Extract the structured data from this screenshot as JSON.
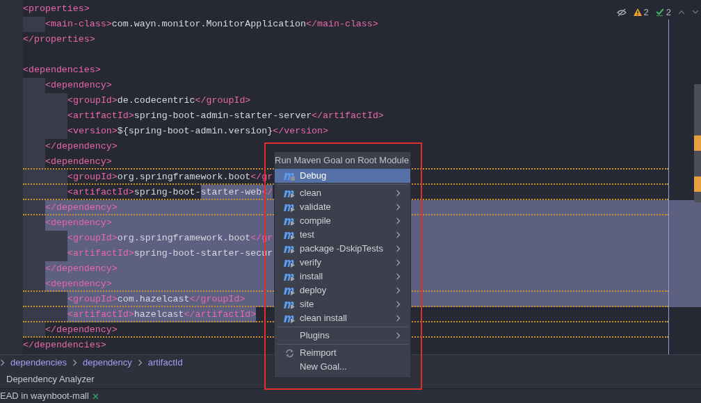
{
  "editor": {
    "inspections": {
      "warnings": "2",
      "weak_warnings": "2"
    },
    "lines": [
      {
        "selected": false,
        "warning": false,
        "tokens": [
          {
            "kind": "tag",
            "text": "<properties>"
          }
        ]
      },
      {
        "selected": false,
        "warning": false,
        "tokens": [
          {
            "kind": "indent"
          },
          {
            "kind": "tag",
            "text": "<main-class>"
          },
          {
            "kind": "text",
            "text": "com.wayn.monitor.MonitorApplication"
          },
          {
            "kind": "tag",
            "text": "</main-class>"
          }
        ]
      },
      {
        "selected": false,
        "warning": false,
        "tokens": [
          {
            "kind": "tag",
            "text": "</properties>"
          }
        ]
      },
      {
        "selected": false,
        "warning": false
      },
      {
        "selected": false,
        "warning": false,
        "tokens": [
          {
            "kind": "tag",
            "text": "<dependencies>"
          }
        ]
      },
      {
        "selected": false,
        "warning": false,
        "tokens": [
          {
            "kind": "indent"
          },
          {
            "kind": "tag",
            "text": "<dependency>"
          }
        ]
      },
      {
        "selected": false,
        "warning": false,
        "tokens": [
          {
            "kind": "indent"
          },
          {
            "kind": "indent"
          },
          {
            "kind": "tag",
            "text": "<groupId>"
          },
          {
            "kind": "text",
            "text": "de.codecentric"
          },
          {
            "kind": "tag",
            "text": "</groupId>"
          }
        ]
      },
      {
        "selected": false,
        "warning": false,
        "tokens": [
          {
            "kind": "indent"
          },
          {
            "kind": "indent"
          },
          {
            "kind": "tag",
            "text": "<artifactId>"
          },
          {
            "kind": "text",
            "text": "spring-boot-admin-starter-server"
          },
          {
            "kind": "tag",
            "text": "</artifactId>"
          }
        ]
      },
      {
        "selected": false,
        "warning": false,
        "tokens": [
          {
            "kind": "indent"
          },
          {
            "kind": "indent"
          },
          {
            "kind": "tag",
            "text": "<version>"
          },
          {
            "kind": "text",
            "text": "${spring-boot-admin.version}"
          },
          {
            "kind": "tag",
            "text": "</version>"
          }
        ]
      },
      {
        "selected": false,
        "warning": false,
        "tokens": [
          {
            "kind": "indent"
          },
          {
            "kind": "tag",
            "text": "</dependency>"
          }
        ]
      },
      {
        "selected": false,
        "warning": true,
        "tokens": [
          {
            "kind": "indent"
          },
          {
            "kind": "tag",
            "text": "<dependency>"
          }
        ]
      },
      {
        "selected": false,
        "warning": true,
        "tokens": [
          {
            "kind": "indent"
          },
          {
            "kind": "indent"
          },
          {
            "kind": "tag",
            "text": "<groupId>"
          },
          {
            "kind": "text",
            "text": "org.springframework.boot"
          },
          {
            "kind": "tag",
            "text": "</gr"
          }
        ]
      },
      {
        "selected": false,
        "warning": true,
        "tokens": [
          {
            "kind": "indent"
          },
          {
            "kind": "indent"
          },
          {
            "kind": "tag",
            "text": "<artifactId>"
          },
          {
            "kind": "text",
            "text": "spring-boot-"
          },
          {
            "kind": "text",
            "text": "starter-web",
            "selected": true
          },
          {
            "kind": "tag",
            "text": "</",
            "selected": true
          }
        ]
      },
      {
        "selected": true,
        "warning": true,
        "tokens": [
          {
            "kind": "indent"
          },
          {
            "kind": "tag",
            "text": "</dependency>"
          }
        ]
      },
      {
        "selected": true,
        "warning": false,
        "tokens": [
          {
            "kind": "indent"
          },
          {
            "kind": "tag",
            "text": "<dependency>"
          }
        ]
      },
      {
        "selected": true,
        "warning": false,
        "tokens": [
          {
            "kind": "indent"
          },
          {
            "kind": "indent"
          },
          {
            "kind": "tag",
            "text": "<groupId>"
          },
          {
            "kind": "text",
            "text": "org.springframework.boot"
          },
          {
            "kind": "tag",
            "text": "</gr"
          }
        ]
      },
      {
        "selected": true,
        "warning": false,
        "tokens": [
          {
            "kind": "indent"
          },
          {
            "kind": "indent"
          },
          {
            "kind": "tag",
            "text": "<artifactId>"
          },
          {
            "kind": "text",
            "text": "spring-boot-starter-secur"
          }
        ]
      },
      {
        "selected": true,
        "warning": false,
        "tokens": [
          {
            "kind": "indent"
          },
          {
            "kind": "tag",
            "text": "</dependency>"
          }
        ]
      },
      {
        "selected": true,
        "warning": true,
        "tokens": [
          {
            "kind": "indent"
          },
          {
            "kind": "tag",
            "text": "<dependency>"
          }
        ]
      },
      {
        "selected": true,
        "warning": true,
        "tokens": [
          {
            "kind": "indent"
          },
          {
            "kind": "indent"
          },
          {
            "kind": "tag",
            "text": "<groupId>"
          },
          {
            "kind": "text",
            "text": "com.hazelcast"
          },
          {
            "kind": "tag",
            "text": "</groupId>"
          }
        ]
      },
      {
        "selected": false,
        "warning": true,
        "tokens": [
          {
            "kind": "indent"
          },
          {
            "kind": "indent"
          },
          {
            "kind": "tag",
            "text": "<artifactId>",
            "selected": true
          },
          {
            "kind": "text",
            "text": "hazelcast",
            "selected": true
          },
          {
            "kind": "tag",
            "text": "</artifactId>",
            "selected": true
          }
        ]
      },
      {
        "selected": false,
        "warning": true,
        "tokens": [
          {
            "kind": "indent"
          },
          {
            "kind": "tag",
            "text": "</dependency>"
          }
        ]
      },
      {
        "selected": false,
        "warning": false,
        "tokens": [
          {
            "kind": "tag",
            "text": "</dependencies>"
          }
        ]
      }
    ]
  },
  "menu": {
    "title": "Run Maven Goal on Root Module",
    "items": [
      {
        "kind": "goal",
        "label": "Debug",
        "selected": true,
        "submenu": false
      },
      {
        "kind": "separator"
      },
      {
        "kind": "goal",
        "label": "clean",
        "selected": false,
        "submenu": true
      },
      {
        "kind": "goal",
        "label": "validate",
        "selected": false,
        "submenu": true
      },
      {
        "kind": "goal",
        "label": "compile",
        "selected": false,
        "submenu": true
      },
      {
        "kind": "goal",
        "label": "test",
        "selected": false,
        "submenu": true
      },
      {
        "kind": "goal",
        "label": "package -DskipTests",
        "selected": false,
        "submenu": true
      },
      {
        "kind": "goal",
        "label": "verify",
        "selected": false,
        "submenu": true
      },
      {
        "kind": "goal",
        "label": "install",
        "selected": false,
        "submenu": true
      },
      {
        "kind": "goal",
        "label": "deploy",
        "selected": false,
        "submenu": true
      },
      {
        "kind": "goal",
        "label": "site",
        "selected": false,
        "submenu": true
      },
      {
        "kind": "goal",
        "label": "clean install",
        "selected": false,
        "submenu": true
      },
      {
        "kind": "separator"
      },
      {
        "kind": "plain",
        "label": "Plugins",
        "selected": false,
        "submenu": true
      },
      {
        "kind": "separator"
      },
      {
        "kind": "reimport",
        "label": "Reimport",
        "selected": false,
        "submenu": false
      },
      {
        "kind": "plain",
        "label": "New Goal...",
        "selected": false,
        "submenu": false
      }
    ]
  },
  "breadcrumbs": [
    "dependencies",
    "dependency",
    "artifactId"
  ],
  "tool_window": {
    "title": "Dependency Analyzer"
  },
  "status_bar": {
    "text": "EAD in waynboot-mall"
  }
}
